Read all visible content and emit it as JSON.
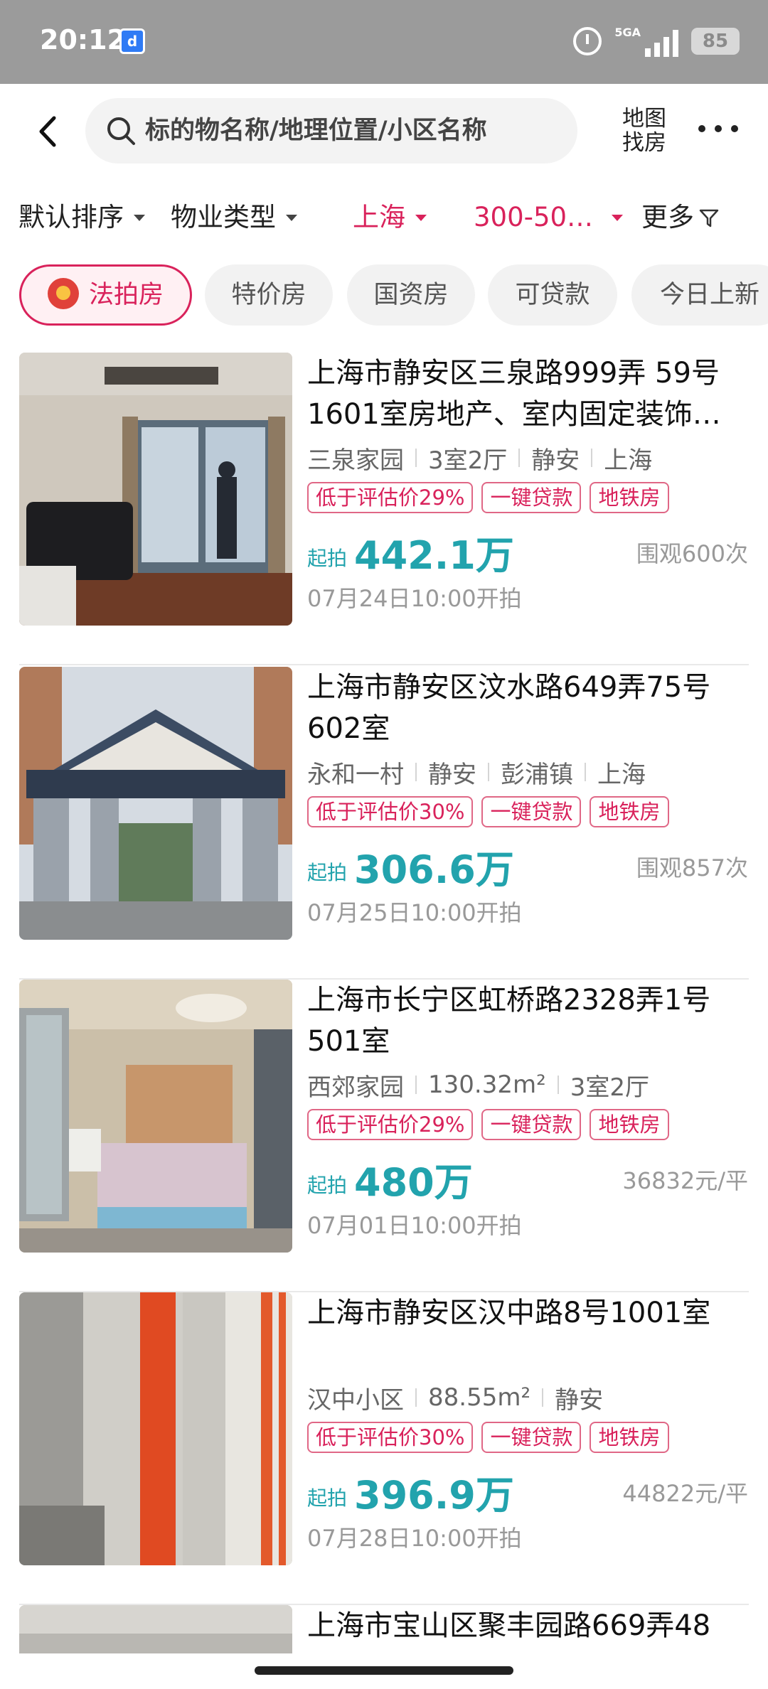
{
  "status_bar": {
    "time": "20:12",
    "network": "5GA",
    "battery": "85"
  },
  "header": {
    "search_placeholder": "标的物名称/地理位置/小区名称",
    "map_search_line1": "地图",
    "map_search_line2": "找房"
  },
  "filters": [
    {
      "label": "默认排序",
      "active": false
    },
    {
      "label": "物业类型",
      "active": false
    },
    {
      "label": "上海",
      "active": true
    },
    {
      "label": "300-50…",
      "active": true
    },
    {
      "label": "更多",
      "active": false
    }
  ],
  "chips": [
    {
      "label": "法拍房",
      "active": true
    },
    {
      "label": "特价房",
      "active": false
    },
    {
      "label": "国资房",
      "active": false
    },
    {
      "label": "可贷款",
      "active": false
    },
    {
      "label": "今日上新",
      "active": false
    }
  ],
  "listings": [
    {
      "title": "上海市静安区三泉路999弄 59号1601室房地产、室内固定装饰…",
      "meta": [
        "三泉家园",
        "3室2厅",
        "静安",
        "上海"
      ],
      "tags": [
        "低于评估价29%",
        "一键贷款",
        "地铁房"
      ],
      "price_label": "起拍",
      "price": "442.1万",
      "side_info": "围观600次",
      "auction_time": "07月24日10:00开拍",
      "image_icon": "living-room-photo"
    },
    {
      "title": "上海市静安区汶水路649弄75号602室",
      "meta": [
        "永和一村",
        "静安",
        "彭浦镇",
        "上海"
      ],
      "tags": [
        "低于评估价30%",
        "一键贷款",
        "地铁房"
      ],
      "price_label": "起拍",
      "price": "306.6万",
      "side_info": "围观857次",
      "auction_time": "07月25日10:00开拍",
      "image_icon": "community-gate-photo"
    },
    {
      "title": "上海市长宁区虹桥路2328弄1号501室",
      "meta": [
        "西郊家园",
        "130.32m²",
        "3室2厅"
      ],
      "tags": [
        "低于评估价29%",
        "一键贷款",
        "地铁房"
      ],
      "price_label": "起拍",
      "price": "480万",
      "side_info": "36832元/平",
      "auction_time": "07月01日10:00开拍",
      "image_icon": "bedroom-photo"
    },
    {
      "title": "上海市静安区汉中路8号1001室",
      "meta": [
        "汉中小区",
        "88.55m²",
        "静安"
      ],
      "tags": [
        "低于评估价30%",
        "一键贷款",
        "地铁房"
      ],
      "price_label": "起拍",
      "price": "396.9万",
      "side_info": "44822元/平",
      "auction_time": "07月28日10:00开拍",
      "image_icon": "building-pillar-photo"
    }
  ],
  "partial_listing": {
    "title": "上海市宝山区聚丰园路669弄48"
  }
}
